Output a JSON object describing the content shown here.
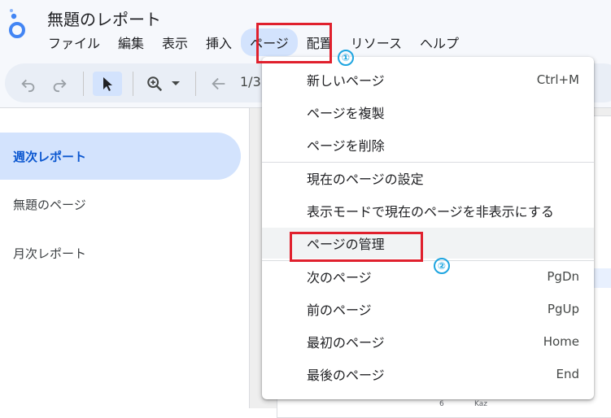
{
  "app": {
    "title": "無題のレポート",
    "menus": [
      "ファイル",
      "編集",
      "表示",
      "挿入",
      "ページ",
      "配置",
      "リソース",
      "ヘルプ"
    ],
    "active_menu": "ページ"
  },
  "toolbar": {
    "page_indicator": "1/3",
    "icons": [
      "undo-icon",
      "redo-icon",
      "select-arrow-icon",
      "zoom-icon",
      "dropdown-caret-icon",
      "back-arrow-icon"
    ]
  },
  "sidebar": {
    "pages": [
      {
        "label": "週次レポート",
        "active": true
      },
      {
        "label": "無題のページ",
        "active": false
      },
      {
        "label": "月次レポート",
        "active": false
      }
    ]
  },
  "page_menu": {
    "items": [
      {
        "label": "新しいページ",
        "shortcut": "Ctrl+M"
      },
      {
        "label": "ページを複製",
        "shortcut": ""
      },
      {
        "label": "ページを削除",
        "shortcut": ""
      },
      {
        "label": "現在のページの設定",
        "shortcut": ""
      },
      {
        "label": "表示モードで現在のページを非表示にする",
        "shortcut": ""
      },
      {
        "label": "ページの管理",
        "shortcut": ""
      },
      {
        "label": "次のページ",
        "shortcut": "PgDn"
      },
      {
        "label": "前のページ",
        "shortcut": "PgUp"
      },
      {
        "label": "最初のページ",
        "shortcut": "Home"
      },
      {
        "label": "最後のページ",
        "shortcut": "End"
      }
    ]
  },
  "annotations": {
    "step1": "①",
    "step2": "②",
    "highlight_color": "#e0202d",
    "marker_color": "#1ea5e0"
  },
  "canvas_fragments": [
    "6",
    "Kaz"
  ],
  "colors": {
    "accent": "#0b57d0",
    "active_bg": "#d3e3fd",
    "header_bg": "#f6f8fc"
  }
}
